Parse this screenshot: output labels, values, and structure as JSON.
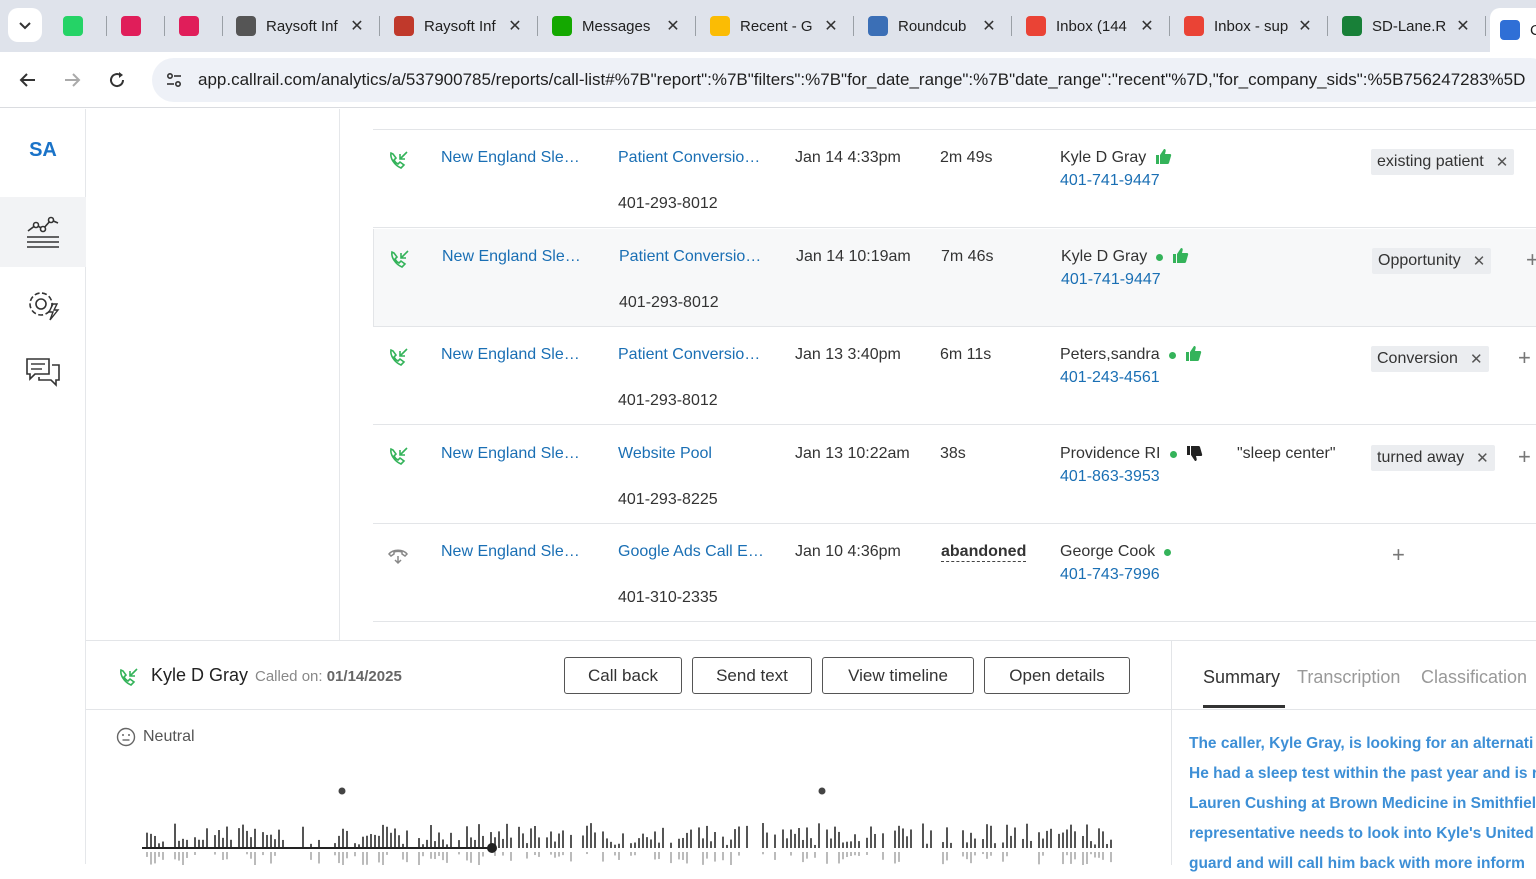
{
  "browser": {
    "tabs": [
      {
        "label": "",
        "icon": "whatsapp-icon",
        "color": "#25D366"
      },
      {
        "label": "",
        "icon": "slack-icon",
        "color": "#E01E5A"
      },
      {
        "label": "",
        "icon": "slack-icon",
        "color": "#E01E5A"
      },
      {
        "label": "Raysoft Inf",
        "icon": "globe-icon",
        "color": "#555555"
      },
      {
        "label": "Raysoft Inf",
        "icon": "raysoft-icon",
        "color": "#c0392b"
      },
      {
        "label": "Messages",
        "icon": "upwork-icon",
        "color": "#14a800"
      },
      {
        "label": "Recent - G",
        "icon": "google-drive-icon",
        "color": "#fbbc04"
      },
      {
        "label": "Roundcub",
        "icon": "roundcube-icon",
        "color": "#3b6fb6"
      },
      {
        "label": "Inbox (144",
        "icon": "gmail-icon",
        "color": "#ea4335"
      },
      {
        "label": "Inbox - sup",
        "icon": "gmail-icon",
        "color": "#ea4335"
      },
      {
        "label": "SD-Lane.R",
        "icon": "sheets-icon",
        "color": "#188038"
      },
      {
        "label": "C",
        "icon": "callrail-icon",
        "color": "#2f6fd6"
      }
    ],
    "url": "app.callrail.com/analytics/a/537900785/reports/call-list#%7B\"report\":%7B\"filters\":%7B\"for_date_range\":%7B\"date_range\":\"recent\"%7D,\"for_company_sids\":%5B756247283%5D"
  },
  "rail": {
    "badge": "SA"
  },
  "calls": [
    {
      "company": "New England Sle…",
      "source": "Patient Conversio…",
      "tracking_number": "401-293-8012",
      "datetime": "Jan 14 4:33pm",
      "duration": "2m 49s",
      "caller": "Kyle D Gray",
      "caller_phone": "401-741-9447",
      "keyword": "",
      "tag": "existing patient",
      "rating": "thumbs-up"
    },
    {
      "company": "New England Sle…",
      "source": "Patient Conversio…",
      "tracking_number": "401-293-8012",
      "datetime": "Jan 14 10:19am",
      "duration": "7m 46s",
      "caller": "Kyle D Gray",
      "caller_phone": "401-741-9447",
      "keyword": "",
      "tag": "Opportunity",
      "rating": "thumbs-up"
    },
    {
      "company": "New England Sle…",
      "source": "Patient Conversio…",
      "tracking_number": "401-293-8012",
      "datetime": "Jan 13 3:40pm",
      "duration": "6m 11s",
      "caller": "Peters,sandra",
      "caller_phone": "401-243-4561",
      "keyword": "",
      "tag": "Conversion",
      "rating": "thumbs-up"
    },
    {
      "company": "New England Sle…",
      "source": "Website Pool",
      "tracking_number": "401-293-8225",
      "datetime": "Jan 13 10:22am",
      "duration": "38s",
      "caller": "Providence RI",
      "caller_phone": "401-863-3953",
      "keyword": "\"sleep center\"",
      "tag": "turned away",
      "rating": "thumbs-down"
    },
    {
      "company": "New England Sle…",
      "source": "Google Ads Call E…",
      "tracking_number": "401-310-2335",
      "datetime": "Jan 10 4:36pm",
      "duration": "abandoned",
      "caller": "George Cook",
      "caller_phone": "401-743-7996",
      "keyword": "",
      "tag": "",
      "rating": ""
    }
  ],
  "detail": {
    "caller_name": "Kyle D Gray",
    "called_on_label": "Called on:",
    "called_on_date": "01/14/2025",
    "buttons": {
      "call_back": "Call back",
      "send_text": "Send text",
      "view_timeline": "View timeline",
      "open_details": "Open details"
    },
    "sentiment": "Neutral",
    "tabs": {
      "summary": "Summary",
      "transcription": "Transcription",
      "classification": "Classification"
    },
    "summary_lines": [
      "The caller, Kyle Gray, is looking for an alternati",
      "He had a sleep test within the past year and is r",
      "Lauren Cushing at Brown Medicine in Smithfiel",
      "representative needs to look into Kyle's United",
      "guard and will call him back with more inform"
    ]
  },
  "colors": {
    "link": "#1a6fb4",
    "accent": "#2f6fd6",
    "status_green": "#34b35a",
    "summary_text": "#3d8fd6"
  }
}
